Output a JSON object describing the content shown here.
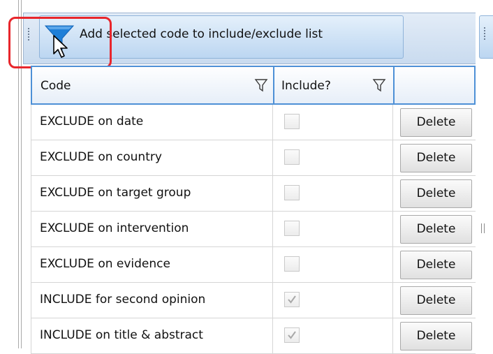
{
  "toolbar": {
    "add_button_label": "Add selected code to include/exclude list"
  },
  "grid": {
    "columns": [
      {
        "label": "Code"
      },
      {
        "label": "Include?"
      },
      {
        "label": ""
      }
    ],
    "rows": [
      {
        "code": "EXCLUDE on date",
        "include": false,
        "action": "Delete"
      },
      {
        "code": "EXCLUDE on country",
        "include": false,
        "action": "Delete"
      },
      {
        "code": "EXCLUDE on target group",
        "include": false,
        "action": "Delete"
      },
      {
        "code": "EXCLUDE on intervention",
        "include": false,
        "action": "Delete"
      },
      {
        "code": "EXCLUDE on evidence",
        "include": false,
        "action": "Delete"
      },
      {
        "code": "INCLUDE for second opinion",
        "include": true,
        "action": "Delete"
      },
      {
        "code": "INCLUDE on title & abstract",
        "include": true,
        "action": "Delete"
      }
    ]
  },
  "icons": {
    "add_button_icon": "funnel-icon",
    "column_filter_icon": "filter-icon",
    "pointer": "mouse-pointer-icon"
  },
  "colors": {
    "highlight": "#e8262c",
    "toolbar_bg": "#c9dbef",
    "header_border": "#4d90d6",
    "funnel": "#1e7fd8"
  }
}
